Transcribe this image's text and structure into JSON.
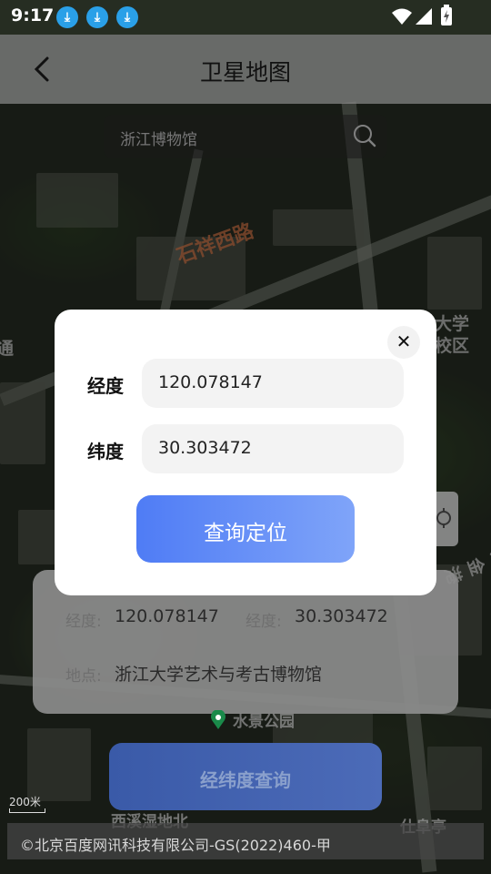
{
  "status_bar": {
    "time": "9:17",
    "download_icons": [
      "download-icon",
      "download-icon",
      "download-icon"
    ]
  },
  "app_bar": {
    "title": "卫星地图",
    "back_icon": "chevron-left-icon"
  },
  "search": {
    "value": "浙江博物馆",
    "icon": "search-icon"
  },
  "map": {
    "labels": {
      "road": "石祥西路",
      "campus": "大学\n校区",
      "park": "水景公园",
      "wetland": "西溪湿地北",
      "bottom_right": "仕阜亭",
      "left_edge": "通",
      "right_edge": "紫金港"
    },
    "scale": "200米",
    "copyright": "©北京百度网讯科技有限公司-GS(2022)460-甲"
  },
  "info_card": {
    "longitude_label": "经度:",
    "longitude_value": "120.078147",
    "latitude_label": "经度:",
    "latitude_value": "30.303472",
    "place_label": "地点:",
    "place_value": "浙江大学艺术与考古博物馆"
  },
  "bottom_button": {
    "label": "经纬度查询"
  },
  "dialog": {
    "close_icon": "close-icon",
    "longitude_label": "经度",
    "longitude_value": "120.078147",
    "latitude_label": "纬度",
    "latitude_value": "30.303472",
    "submit_label": "查询定位"
  },
  "colors": {
    "primary": "#4f7cf5",
    "primary_light": "#7fa4f9",
    "download_badge": "#2aa0e8"
  }
}
